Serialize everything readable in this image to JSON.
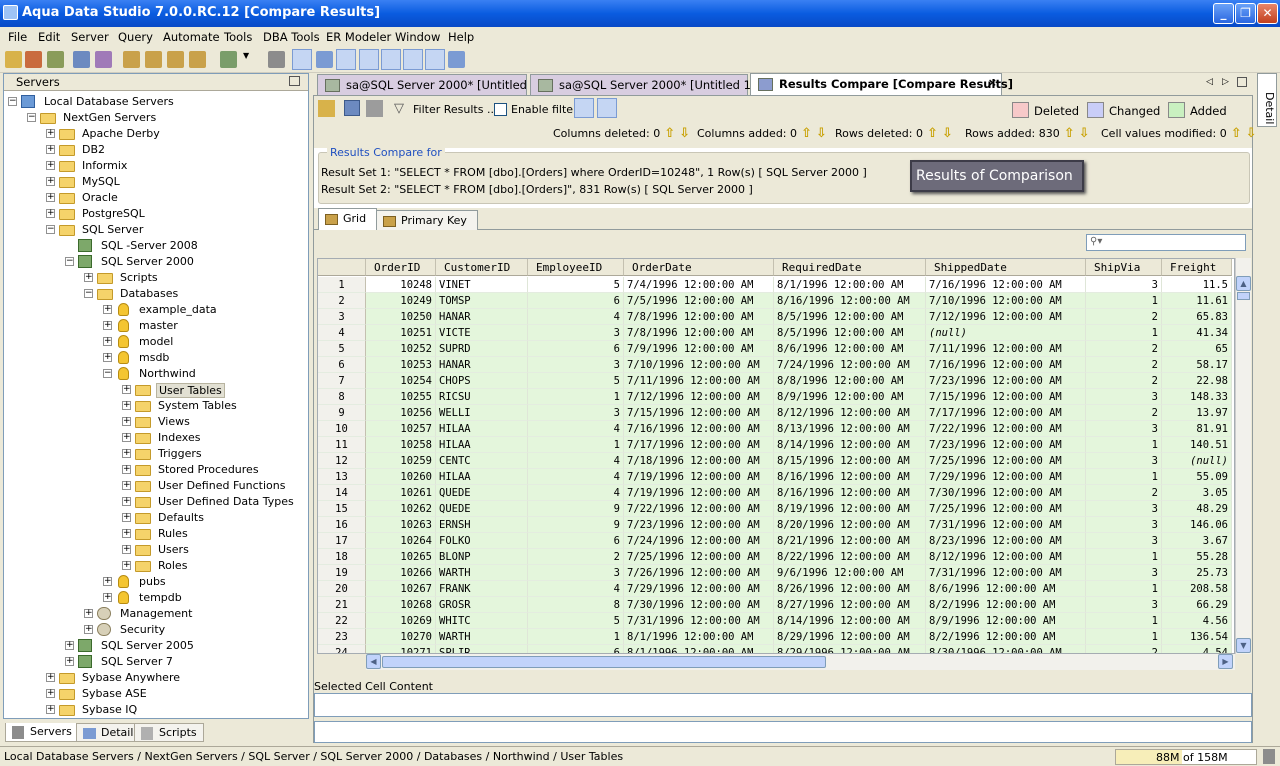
{
  "window": {
    "title": "Aqua Data Studio 7.0.0.RC.12 [Compare Results]",
    "min": "_",
    "max": "❐",
    "close": "✕"
  },
  "menu": [
    "File",
    "Edit",
    "Server",
    "Query",
    "Automate",
    "Tools",
    "DBA Tools",
    "ER Modeler",
    "Window",
    "Help"
  ],
  "servers_panel": {
    "title": "Servers",
    "tree": [
      {
        "label": "Local Database Servers",
        "level": 0,
        "icon": "net-icon",
        "exp": "−"
      },
      {
        "label": "NextGen Servers",
        "level": 1,
        "icon": "folder-icon",
        "exp": "−"
      },
      {
        "label": "Apache Derby",
        "level": 2,
        "icon": "folder-icon",
        "exp": "+"
      },
      {
        "label": "DB2",
        "level": 2,
        "icon": "folder-icon",
        "exp": "+"
      },
      {
        "label": "Informix",
        "level": 2,
        "icon": "folder-icon",
        "exp": "+"
      },
      {
        "label": "MySQL",
        "level": 2,
        "icon": "folder-icon",
        "exp": "+"
      },
      {
        "label": "Oracle",
        "level": 2,
        "icon": "folder-icon",
        "exp": "+"
      },
      {
        "label": "PostgreSQL",
        "level": 2,
        "icon": "folder-icon",
        "exp": "+"
      },
      {
        "label": "SQL Server",
        "level": 2,
        "icon": "folder-icon",
        "exp": "−"
      },
      {
        "label": "SQL -Server 2008",
        "level": 3,
        "icon": "server-icon",
        "exp": ""
      },
      {
        "label": "SQL Server 2000",
        "level": 3,
        "icon": "server-icon",
        "exp": "−"
      },
      {
        "label": "Scripts",
        "level": 4,
        "icon": "folder-icon",
        "exp": "+"
      },
      {
        "label": "Databases",
        "level": 4,
        "icon": "folder-icon",
        "exp": "−"
      },
      {
        "label": "example_data",
        "level": 5,
        "icon": "database-icon",
        "exp": "+"
      },
      {
        "label": "master",
        "level": 5,
        "icon": "database-icon",
        "exp": "+"
      },
      {
        "label": "model",
        "level": 5,
        "icon": "database-icon",
        "exp": "+"
      },
      {
        "label": "msdb",
        "level": 5,
        "icon": "database-icon",
        "exp": "+"
      },
      {
        "label": "Northwind",
        "level": 5,
        "icon": "database-icon",
        "exp": "−"
      },
      {
        "label": "User Tables",
        "level": 6,
        "icon": "folder-icon",
        "exp": "+",
        "selected": true
      },
      {
        "label": "System Tables",
        "level": 6,
        "icon": "folder-icon",
        "exp": "+"
      },
      {
        "label": "Views",
        "level": 6,
        "icon": "folder-icon",
        "exp": "+"
      },
      {
        "label": "Indexes",
        "level": 6,
        "icon": "folder-icon",
        "exp": "+"
      },
      {
        "label": "Triggers",
        "level": 6,
        "icon": "folder-icon",
        "exp": "+"
      },
      {
        "label": "Stored Procedures",
        "level": 6,
        "icon": "folder-icon",
        "exp": "+"
      },
      {
        "label": "User Defined Functions",
        "level": 6,
        "icon": "folder-icon",
        "exp": "+"
      },
      {
        "label": "User Defined Data Types",
        "level": 6,
        "icon": "folder-icon",
        "exp": "+"
      },
      {
        "label": "Defaults",
        "level": 6,
        "icon": "folder-icon",
        "exp": "+"
      },
      {
        "label": "Rules",
        "level": 6,
        "icon": "folder-icon",
        "exp": "+"
      },
      {
        "label": "Users",
        "level": 6,
        "icon": "folder-icon",
        "exp": "+"
      },
      {
        "label": "Roles",
        "level": 6,
        "icon": "folder-icon",
        "exp": "+"
      },
      {
        "label": "pubs",
        "level": 5,
        "icon": "database-icon",
        "exp": "+"
      },
      {
        "label": "tempdb",
        "level": 5,
        "icon": "database-icon",
        "exp": "+"
      },
      {
        "label": "Management",
        "level": 4,
        "icon": "gear-icon",
        "exp": "+"
      },
      {
        "label": "Security",
        "level": 4,
        "icon": "gear-icon",
        "exp": "+"
      },
      {
        "label": "SQL Server 2005",
        "level": 3,
        "icon": "server-icon",
        "exp": "+"
      },
      {
        "label": "SQL Server 7",
        "level": 3,
        "icon": "server-icon",
        "exp": "+"
      },
      {
        "label": "Sybase Anywhere",
        "level": 2,
        "icon": "folder-icon",
        "exp": "+"
      },
      {
        "label": "Sybase ASE",
        "level": 2,
        "icon": "folder-icon",
        "exp": "+"
      },
      {
        "label": "Sybase IQ",
        "level": 2,
        "icon": "folder-icon",
        "exp": "+"
      }
    ],
    "tabs": [
      "Servers",
      "Detail",
      "Scripts"
    ]
  },
  "doc_tabs": [
    {
      "label": "sa@SQL Server 2000* [Untitled 9]"
    },
    {
      "label": "sa@SQL Server 2000* [Untitled 10]"
    },
    {
      "label": "Results Compare [Compare Results]",
      "active": true
    }
  ],
  "tab_close": "×",
  "results_toolbar": {
    "filter_label": "Filter Results ...",
    "enable_filter": "Enable filter",
    "legend": [
      {
        "label": "Deleted",
        "color": "#f7c9c9"
      },
      {
        "label": "Changed",
        "color": "#c9cdf7"
      },
      {
        "label": "Added",
        "color": "#c9f0c0"
      }
    ],
    "stats": [
      {
        "label": "Columns deleted: 0"
      },
      {
        "label": "Columns added: 0"
      },
      {
        "label": "Rows deleted: 0"
      },
      {
        "label": "Rows added: 830"
      },
      {
        "label": "Cell values modified: 0"
      }
    ],
    "up_arrow": "⇧",
    "down_arrow": "⇩"
  },
  "compare_for": {
    "title": "Results Compare for",
    "set1": "Result Set 1: \"SELECT * FROM [dbo].[Orders] where OrderID=10248\", 1 Row(s)  [ SQL Server 2000 ]",
    "set2": "Result Set 2: \"SELECT * FROM [dbo].[Orders]\", 831 Row(s)  [ SQL Server 2000 ]",
    "annotation": "Results of Comparison"
  },
  "sub_tabs": [
    "Grid",
    "Primary Key"
  ],
  "grid": {
    "columns": [
      "OrderID",
      "CustomerID",
      "EmployeeID",
      "OrderDate",
      "RequiredDate",
      "ShippedDate",
      "ShipVia",
      "Freight"
    ],
    "rows": [
      [
        "1",
        "10248",
        "VINET",
        "5",
        "7/4/1996 12:00:00 AM",
        "8/1/1996 12:00:00 AM",
        "7/16/1996 12:00:00 AM",
        "3",
        "11.5"
      ],
      [
        "2",
        "10249",
        "TOMSP",
        "6",
        "7/5/1996 12:00:00 AM",
        "8/16/1996 12:00:00 AM",
        "7/10/1996 12:00:00 AM",
        "1",
        "11.61"
      ],
      [
        "3",
        "10250",
        "HANAR",
        "4",
        "7/8/1996 12:00:00 AM",
        "8/5/1996 12:00:00 AM",
        "7/12/1996 12:00:00 AM",
        "2",
        "65.83"
      ],
      [
        "4",
        "10251",
        "VICTE",
        "3",
        "7/8/1996 12:00:00 AM",
        "8/5/1996 12:00:00 AM",
        "(null)",
        "1",
        "41.34"
      ],
      [
        "5",
        "10252",
        "SUPRD",
        "6",
        "7/9/1996 12:00:00 AM",
        "8/6/1996 12:00:00 AM",
        "7/11/1996 12:00:00 AM",
        "2",
        "65"
      ],
      [
        "6",
        "10253",
        "HANAR",
        "3",
        "7/10/1996 12:00:00 AM",
        "7/24/1996 12:00:00 AM",
        "7/16/1996 12:00:00 AM",
        "2",
        "58.17"
      ],
      [
        "7",
        "10254",
        "CHOPS",
        "5",
        "7/11/1996 12:00:00 AM",
        "8/8/1996 12:00:00 AM",
        "7/23/1996 12:00:00 AM",
        "2",
        "22.98"
      ],
      [
        "8",
        "10255",
        "RICSU",
        "1",
        "7/12/1996 12:00:00 AM",
        "8/9/1996 12:00:00 AM",
        "7/15/1996 12:00:00 AM",
        "3",
        "148.33"
      ],
      [
        "9",
        "10256",
        "WELLI",
        "3",
        "7/15/1996 12:00:00 AM",
        "8/12/1996 12:00:00 AM",
        "7/17/1996 12:00:00 AM",
        "2",
        "13.97"
      ],
      [
        "10",
        "10257",
        "HILAA",
        "4",
        "7/16/1996 12:00:00 AM",
        "8/13/1996 12:00:00 AM",
        "7/22/1996 12:00:00 AM",
        "3",
        "81.91"
      ],
      [
        "11",
        "10258",
        "HILAA",
        "1",
        "7/17/1996 12:00:00 AM",
        "8/14/1996 12:00:00 AM",
        "7/23/1996 12:00:00 AM",
        "1",
        "140.51"
      ],
      [
        "12",
        "10259",
        "CENTC",
        "4",
        "7/18/1996 12:00:00 AM",
        "8/15/1996 12:00:00 AM",
        "7/25/1996 12:00:00 AM",
        "3",
        "(null)"
      ],
      [
        "13",
        "10260",
        "HILAA",
        "4",
        "7/19/1996 12:00:00 AM",
        "8/16/1996 12:00:00 AM",
        "7/29/1996 12:00:00 AM",
        "1",
        "55.09"
      ],
      [
        "14",
        "10261",
        "QUEDE",
        "4",
        "7/19/1996 12:00:00 AM",
        "8/16/1996 12:00:00 AM",
        "7/30/1996 12:00:00 AM",
        "2",
        "3.05"
      ],
      [
        "15",
        "10262",
        "QUEDE",
        "9",
        "7/22/1996 12:00:00 AM",
        "8/19/1996 12:00:00 AM",
        "7/25/1996 12:00:00 AM",
        "3",
        "48.29"
      ],
      [
        "16",
        "10263",
        "ERNSH",
        "9",
        "7/23/1996 12:00:00 AM",
        "8/20/1996 12:00:00 AM",
        "7/31/1996 12:00:00 AM",
        "3",
        "146.06"
      ],
      [
        "17",
        "10264",
        "FOLKO",
        "6",
        "7/24/1996 12:00:00 AM",
        "8/21/1996 12:00:00 AM",
        "8/23/1996 12:00:00 AM",
        "3",
        "3.67"
      ],
      [
        "18",
        "10265",
        "BLONP",
        "2",
        "7/25/1996 12:00:00 AM",
        "8/22/1996 12:00:00 AM",
        "8/12/1996 12:00:00 AM",
        "1",
        "55.28"
      ],
      [
        "19",
        "10266",
        "WARTH",
        "3",
        "7/26/1996 12:00:00 AM",
        "9/6/1996 12:00:00 AM",
        "7/31/1996 12:00:00 AM",
        "3",
        "25.73"
      ],
      [
        "20",
        "10267",
        "FRANK",
        "4",
        "7/29/1996 12:00:00 AM",
        "8/26/1996 12:00:00 AM",
        "8/6/1996 12:00:00 AM",
        "1",
        "208.58"
      ],
      [
        "21",
        "10268",
        "GROSR",
        "8",
        "7/30/1996 12:00:00 AM",
        "8/27/1996 12:00:00 AM",
        "8/2/1996 12:00:00 AM",
        "3",
        "66.29"
      ],
      [
        "22",
        "10269",
        "WHITC",
        "5",
        "7/31/1996 12:00:00 AM",
        "8/14/1996 12:00:00 AM",
        "8/9/1996 12:00:00 AM",
        "1",
        "4.56"
      ],
      [
        "23",
        "10270",
        "WARTH",
        "1",
        "8/1/1996 12:00:00 AM",
        "8/29/1996 12:00:00 AM",
        "8/2/1996 12:00:00 AM",
        "1",
        "136.54"
      ],
      [
        "24",
        "10271",
        "SPLIR",
        "6",
        "8/1/1996 12:00:00 AM",
        "8/29/1996 12:00:00 AM",
        "8/30/1996 12:00:00 AM",
        "2",
        "4.54"
      ]
    ]
  },
  "selected_cell_label": "Selected Cell Content",
  "detail_tab": "Detail",
  "status": {
    "path": "Local Database Servers / NextGen Servers / SQL Server / SQL Server 2000 / Databases / Northwind / User Tables",
    "memory": "88M of 158M",
    "memory_used_fraction": 0.557
  }
}
